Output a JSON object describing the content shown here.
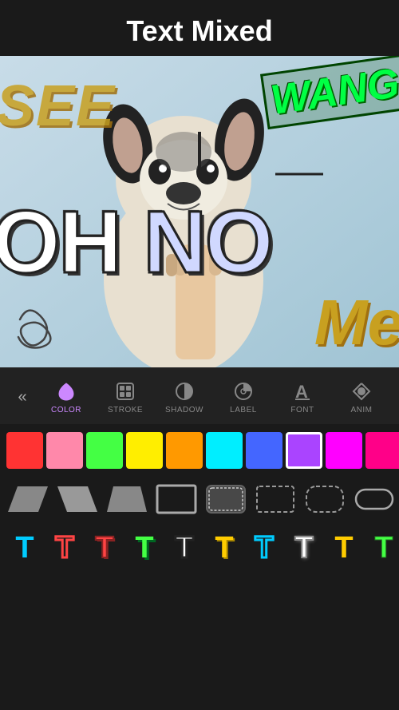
{
  "header": {
    "title": "Text Mixed"
  },
  "canvas": {
    "texts": {
      "see": "SEE",
      "wang": "WANG",
      "oh_no": "OH  NO",
      "me": "Me"
    }
  },
  "toolbar": {
    "back_label": "«",
    "tabs": [
      {
        "id": "color",
        "label": "COLOR",
        "active": true
      },
      {
        "id": "stroke",
        "label": "STROKE",
        "active": false
      },
      {
        "id": "shadow",
        "label": "SHADOW",
        "active": false
      },
      {
        "id": "label",
        "label": "LABEL",
        "active": false
      },
      {
        "id": "font",
        "label": "FONT",
        "active": false
      },
      {
        "id": "anim",
        "label": "ANIM",
        "active": false
      }
    ]
  },
  "colors": [
    {
      "id": "red",
      "value": "#ff3333"
    },
    {
      "id": "pink",
      "value": "#ff88aa"
    },
    {
      "id": "green",
      "value": "#44ff44"
    },
    {
      "id": "yellow",
      "value": "#ffee00"
    },
    {
      "id": "orange",
      "value": "#ff9900"
    },
    {
      "id": "cyan",
      "value": "#00eeff"
    },
    {
      "id": "blue",
      "value": "#4466ff"
    },
    {
      "id": "purple",
      "value": "#aa44ff",
      "selected": true
    },
    {
      "id": "magenta",
      "value": "#ff00ff"
    },
    {
      "id": "hot_pink",
      "value": "#ff0088"
    },
    {
      "id": "dark_red",
      "value": "#cc0000"
    },
    {
      "id": "multi",
      "value": "multi"
    }
  ],
  "shapes": [
    {
      "id": "parallelogram_left"
    },
    {
      "id": "parallelogram_right"
    },
    {
      "id": "trapezoid"
    },
    {
      "id": "rectangle"
    },
    {
      "id": "rounded_rect"
    },
    {
      "id": "dashed_rect"
    },
    {
      "id": "dashed_rounded"
    },
    {
      "id": "pill"
    }
  ],
  "font_styles": [
    {
      "id": "plain",
      "color": "#00ccff"
    },
    {
      "id": "outline",
      "color": "#ff4444"
    },
    {
      "id": "bold_outline",
      "color": "#ff4444"
    },
    {
      "id": "shadow_style",
      "color": "#44ff44"
    },
    {
      "id": "bold_shadow",
      "color": "#ffffff"
    },
    {
      "id": "stroke2",
      "color": "#ffcc00"
    },
    {
      "id": "gradient",
      "color": "#00ccff"
    },
    {
      "id": "outline2",
      "color": "#ffffff"
    },
    {
      "id": "bold2",
      "color": "#ffcc00"
    },
    {
      "id": "flat",
      "color": "#44ff44"
    }
  ]
}
